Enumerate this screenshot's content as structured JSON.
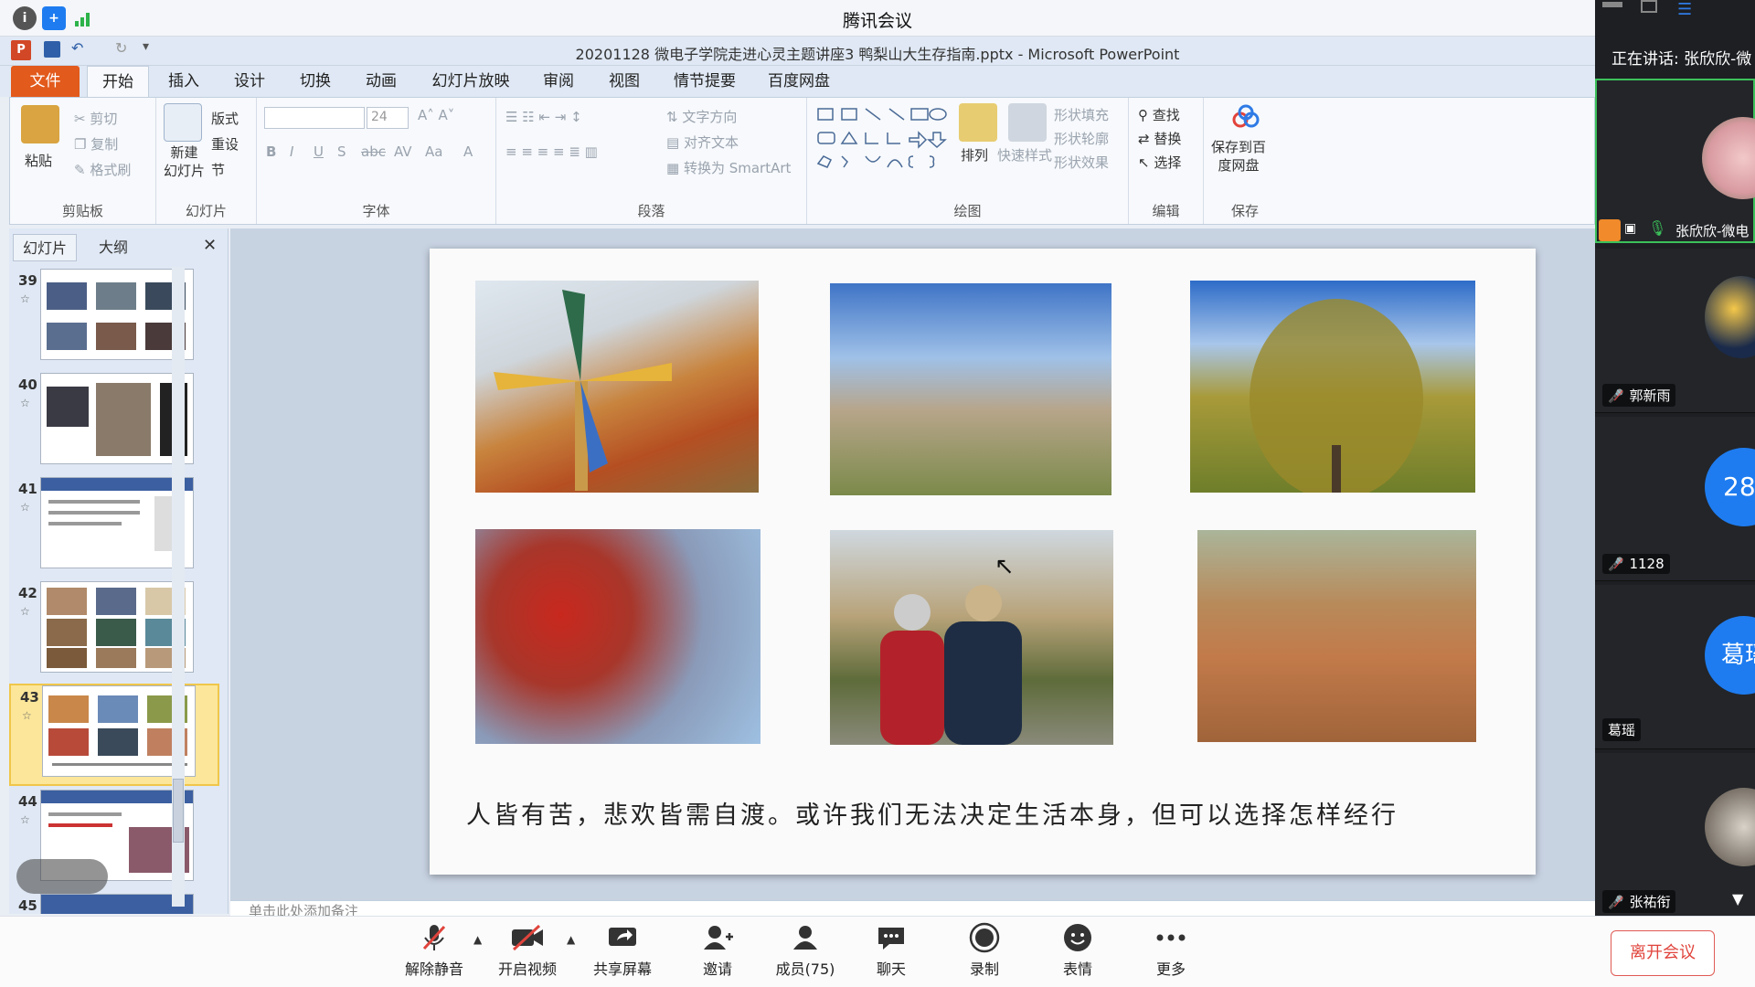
{
  "meeting": {
    "title": "腾讯会议"
  },
  "ppt": {
    "doc_title": "20201128 微电子学院走进心灵主题讲座3 鸭梨山大生存指南.pptx - Microsoft PowerPoint",
    "tabs": [
      "文件",
      "开始",
      "插入",
      "设计",
      "切换",
      "动画",
      "幻灯片放映",
      "审阅",
      "视图",
      "情节提要",
      "百度网盘"
    ],
    "ribbon": {
      "clipboard": {
        "paste": "粘贴",
        "cut": "剪切",
        "copy": "复制",
        "format_painter": "格式刷",
        "label": "剪贴板"
      },
      "slides": {
        "new_slide": "新建\n幻灯片",
        "new_slide_1": "新建",
        "new_slide_2": "幻灯片",
        "layout": "版式",
        "reset": "重设",
        "section": "节",
        "label": "幻灯片"
      },
      "font": {
        "size": "24",
        "label": "字体"
      },
      "paragraph": {
        "text_direction": "文字方向",
        "align_text": "对齐文本",
        "smartart": "转换为 SmartArt",
        "label": "段落"
      },
      "drawing": {
        "arrange": "排列",
        "quick_styles": "快速样式",
        "shape_fill": "形状填充",
        "shape_outline": "形状轮廓",
        "shape_effects": "形状效果",
        "label": "绘图"
      },
      "editing": {
        "find": "查找",
        "replace": "替换",
        "select": "选择",
        "label": "编辑"
      },
      "save": {
        "save_baidu_1": "保存到百",
        "save_baidu_2": "度网盘",
        "label": "保存"
      }
    },
    "panel_tabs": [
      "幻灯片",
      "大纲"
    ],
    "thumbnails": [
      {
        "num": "39"
      },
      {
        "num": "40"
      },
      {
        "num": "41"
      },
      {
        "num": "42"
      },
      {
        "num": "43"
      },
      {
        "num": "44"
      },
      {
        "num": "45"
      }
    ],
    "selected_slide": "43",
    "slide": {
      "caption": "人皆有苦，悲欢皆需自渡。或许我们无法决定生活本身，但可以选择怎样经行"
    },
    "notes_placeholder": "单击此处添加备注"
  },
  "participants": {
    "speaking": "正在讲话: 张欣欣-微",
    "list": [
      {
        "name": "张欣欣-微电",
        "muted": false
      },
      {
        "name": "郭新雨",
        "muted": true
      },
      {
        "name": "1128",
        "muted": true,
        "avatar_text": "28"
      },
      {
        "name": "葛瑶",
        "muted": false,
        "avatar_text": "葛瑶"
      },
      {
        "name": "张祐衔",
        "muted": true
      }
    ]
  },
  "toolbar": {
    "unmute": "解除静音",
    "video": "开启视频",
    "share": "共享屏幕",
    "invite": "邀请",
    "members": "成员(75)",
    "chat": "聊天",
    "record": "录制",
    "emoji": "表情",
    "more": "更多",
    "leave": "离开会议"
  },
  "colors": {
    "file_tab": "#e25a1c",
    "leave": "#e0443c",
    "speaking_border": "#3cc15a",
    "avatar_blue": "#1e7cf0"
  }
}
